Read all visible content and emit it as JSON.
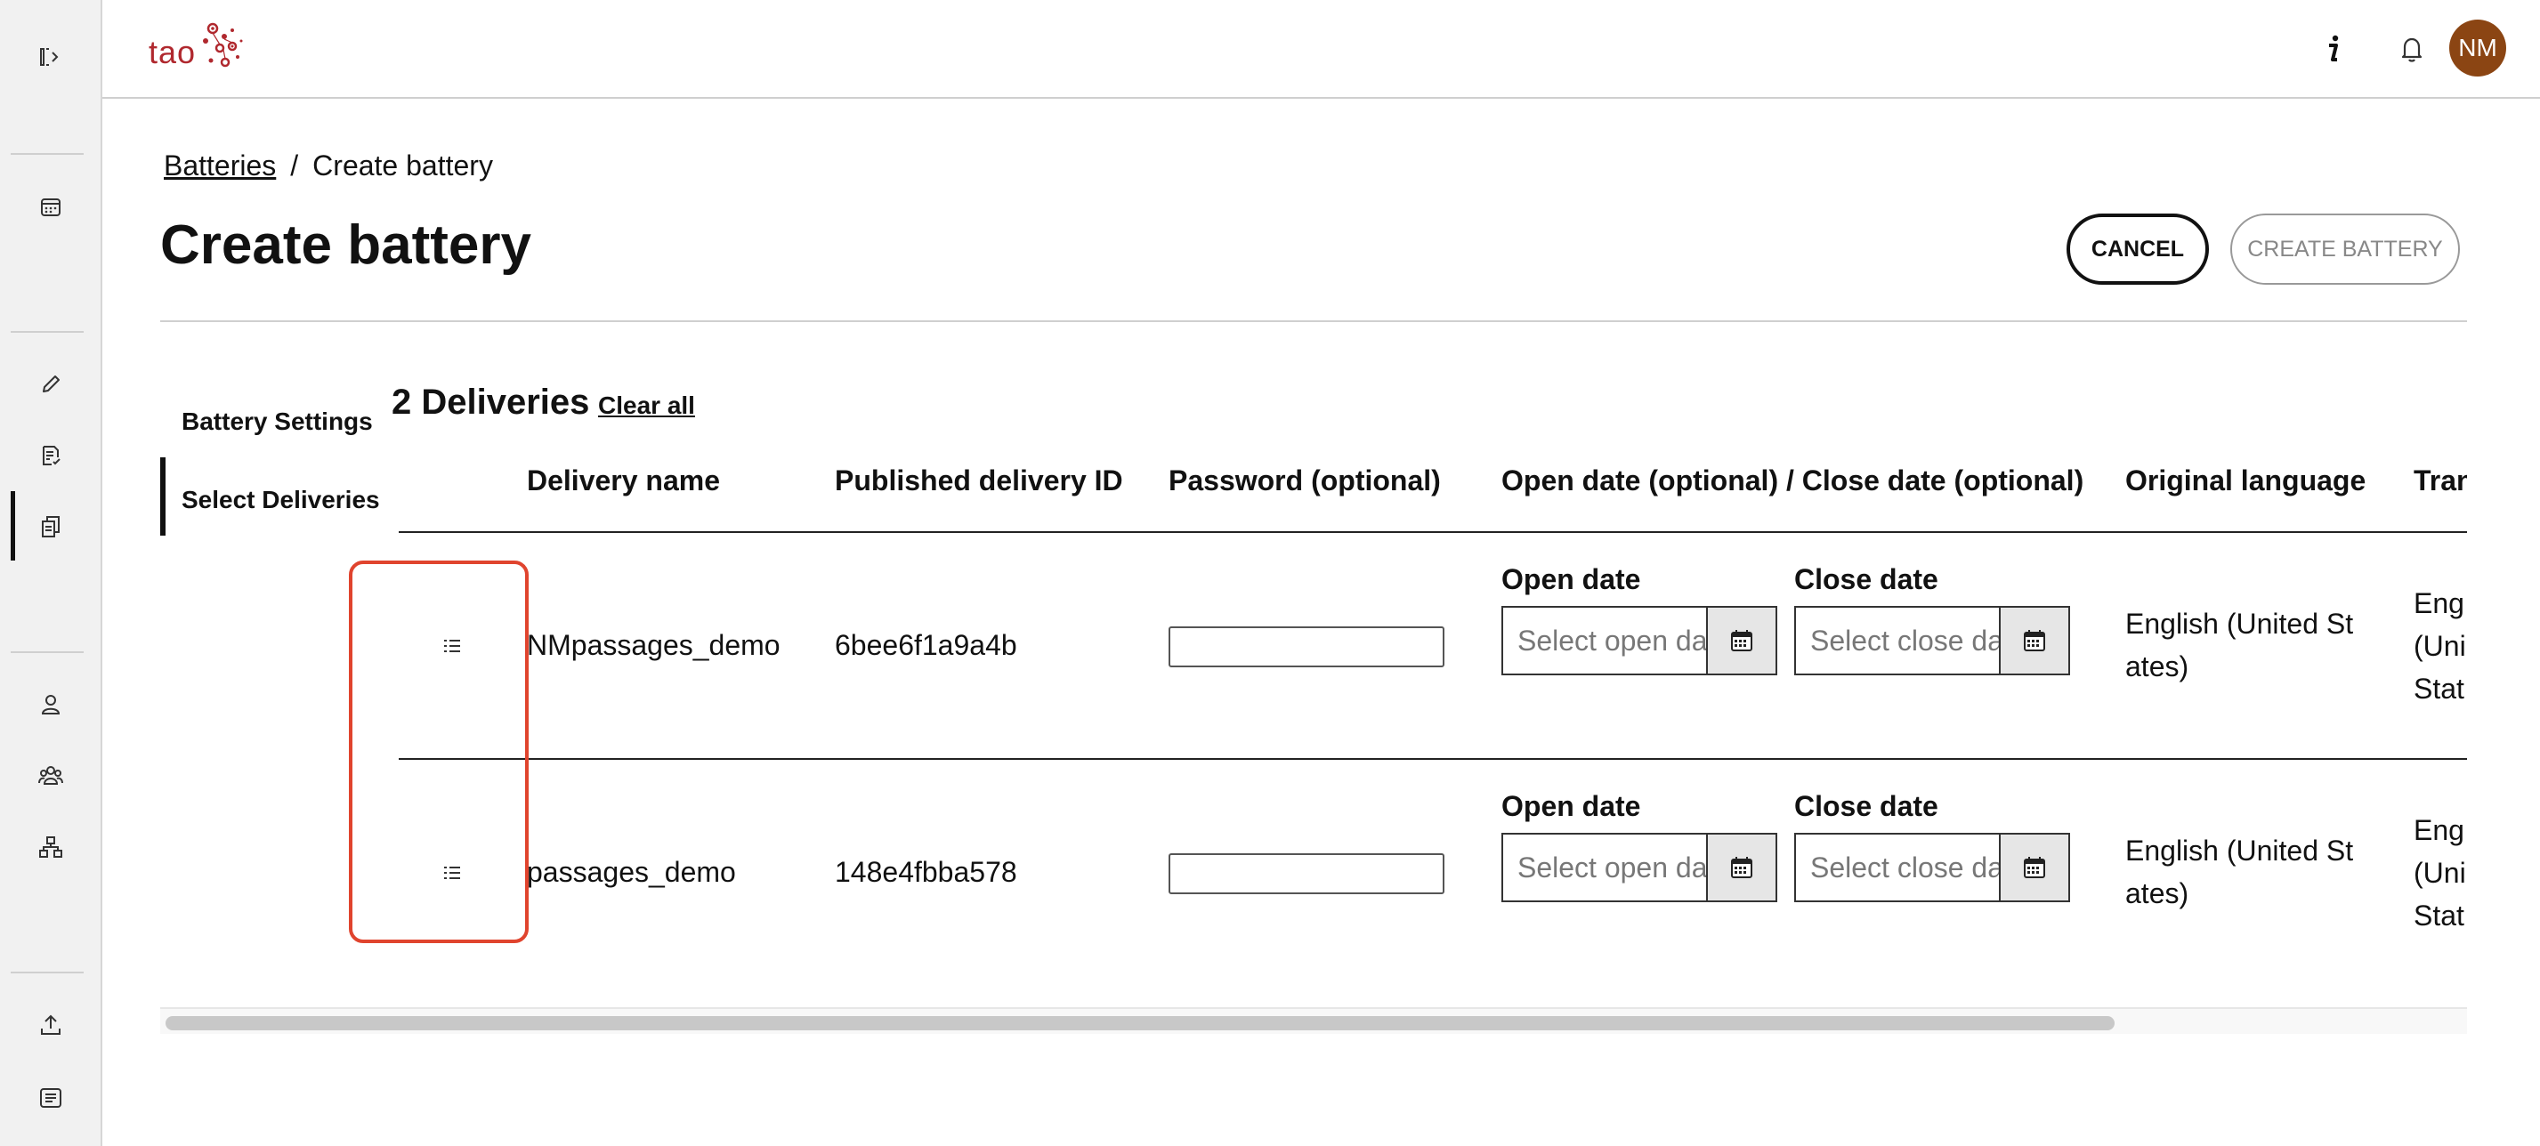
{
  "app": {
    "logo_text": "tao"
  },
  "header": {
    "avatar_initials": "NM"
  },
  "breadcrumb": {
    "parent": "Batteries",
    "separator": "/",
    "current": "Create battery"
  },
  "page": {
    "title": "Create battery"
  },
  "actions": {
    "cancel_label": "CANCEL",
    "create_label": "CREATE BATTERY"
  },
  "sidenav": {
    "items": [
      {
        "label": "Battery Settings"
      },
      {
        "label": "Select Deliveries"
      }
    ],
    "active": "Select Deliveries"
  },
  "deliveries": {
    "title": "2 Deliveries",
    "clear_all": "Clear all",
    "columns": [
      "Delivery name",
      "Published delivery ID",
      "Password (optional)",
      "Open date (optional) / Close date (optional)",
      "Original language",
      "Tran"
    ],
    "rows": [
      {
        "name": "NMpassages_demo",
        "id": "6bee6f1a9a4b",
        "password": "",
        "open_label": "Open date",
        "open_placeholder": "Select open da",
        "close_label": "Close date",
        "close_placeholder": "Select close da",
        "language": "English (United States)",
        "translation": "Eng\n(Uni\nStat"
      },
      {
        "name": "passages_demo",
        "id": "148e4fbba578",
        "password": "",
        "open_label": "Open date",
        "open_placeholder": "Select open da",
        "close_label": "Close date",
        "close_placeholder": "Select close da",
        "language": "English (United States)",
        "translation": "Eng\n(Uni\nStat"
      }
    ]
  },
  "colors": {
    "brand": "#b0282e",
    "avatar_bg": "#8b4513",
    "highlight": "#e0442e"
  },
  "icons": {
    "rail": [
      "sidebar-toggle-icon",
      "calendar-icon",
      "pencil-icon",
      "checklist-icon",
      "documents-icon",
      "user-icon",
      "group-icon",
      "hierarchy-icon",
      "upload-icon",
      "list-icon"
    ],
    "header": [
      "info-icon",
      "bell-icon"
    ],
    "row": [
      "drag-handle-icon",
      "calendar-icon"
    ]
  }
}
